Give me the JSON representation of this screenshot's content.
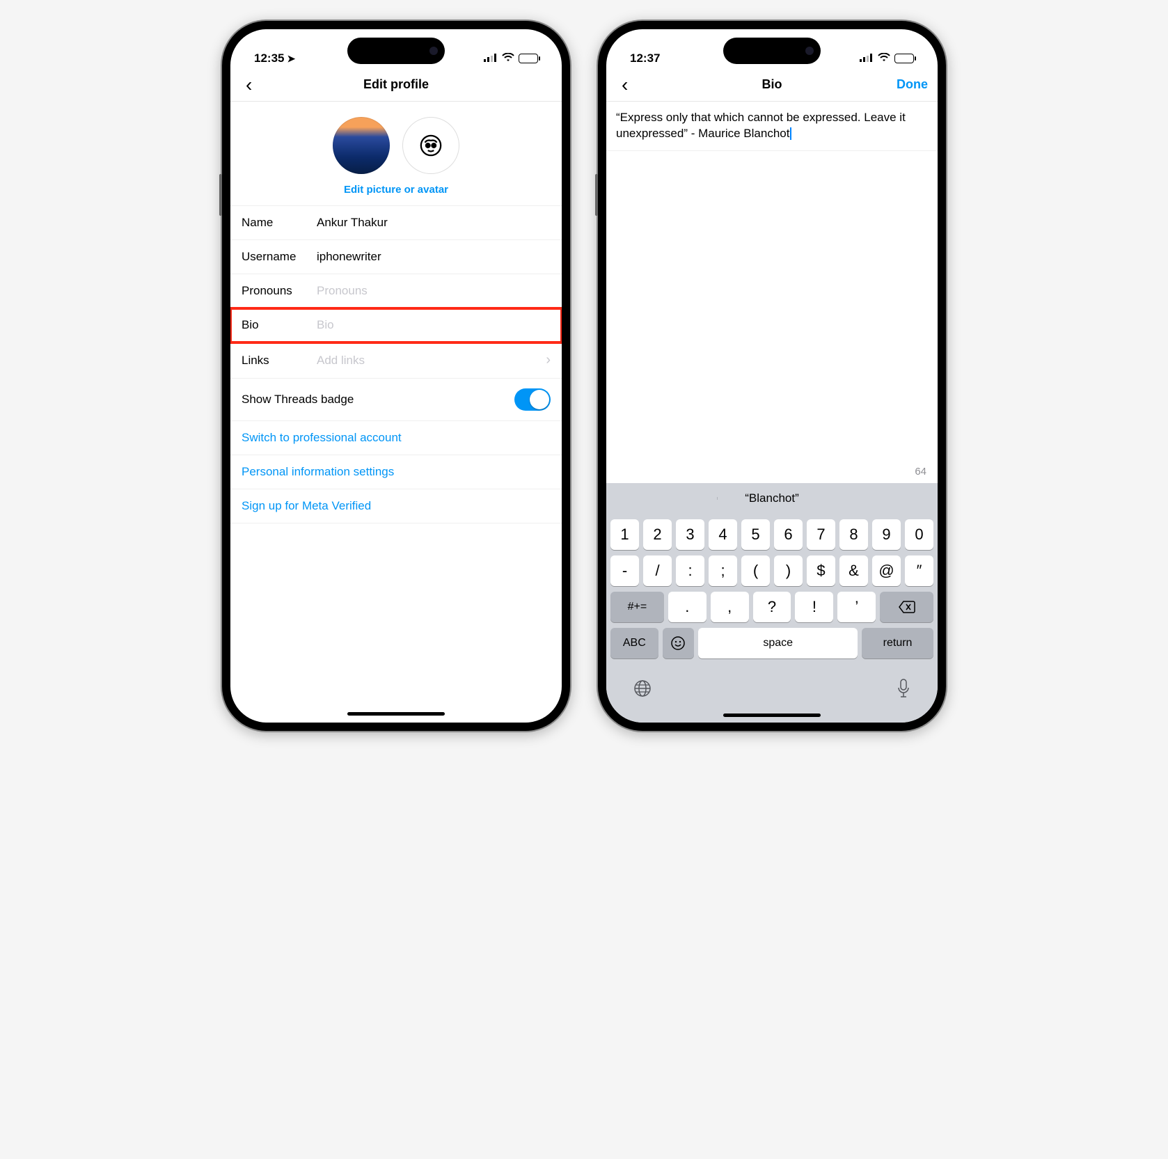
{
  "left": {
    "status": {
      "time": "12:35"
    },
    "nav": {
      "title": "Edit profile"
    },
    "edit_picture_link": "Edit picture or avatar",
    "rows": {
      "name": {
        "label": "Name",
        "value": "Ankur Thakur"
      },
      "username": {
        "label": "Username",
        "value": "iphonewriter"
      },
      "pronouns": {
        "label": "Pronouns",
        "placeholder": "Pronouns"
      },
      "bio": {
        "label": "Bio",
        "placeholder": "Bio"
      },
      "links": {
        "label": "Links",
        "placeholder": "Add links"
      }
    },
    "threads_toggle_label": "Show Threads badge",
    "links_list": {
      "switch_account": "Switch to professional account",
      "personal_info": "Personal information settings",
      "meta_verified": "Sign up for Meta Verified"
    }
  },
  "right": {
    "status": {
      "time": "12:37"
    },
    "nav": {
      "title": "Bio",
      "done": "Done"
    },
    "bio_value": "“Express only that which cannot be expressed. Leave it unexpressed” - Maurice Blanchot",
    "char_count": "64",
    "keyboard": {
      "suggestion": "“Blanchot”",
      "row1": [
        "1",
        "2",
        "3",
        "4",
        "5",
        "6",
        "7",
        "8",
        "9",
        "0"
      ],
      "row2": [
        "-",
        "/",
        ":",
        ";",
        "(",
        ")",
        "$",
        "&",
        "@",
        "″"
      ],
      "row3_mode": "#+=",
      "row3": [
        ".",
        ",",
        "?",
        "!",
        "’"
      ],
      "row4": {
        "abc": "ABC",
        "space": "space",
        "return": "return"
      }
    }
  }
}
